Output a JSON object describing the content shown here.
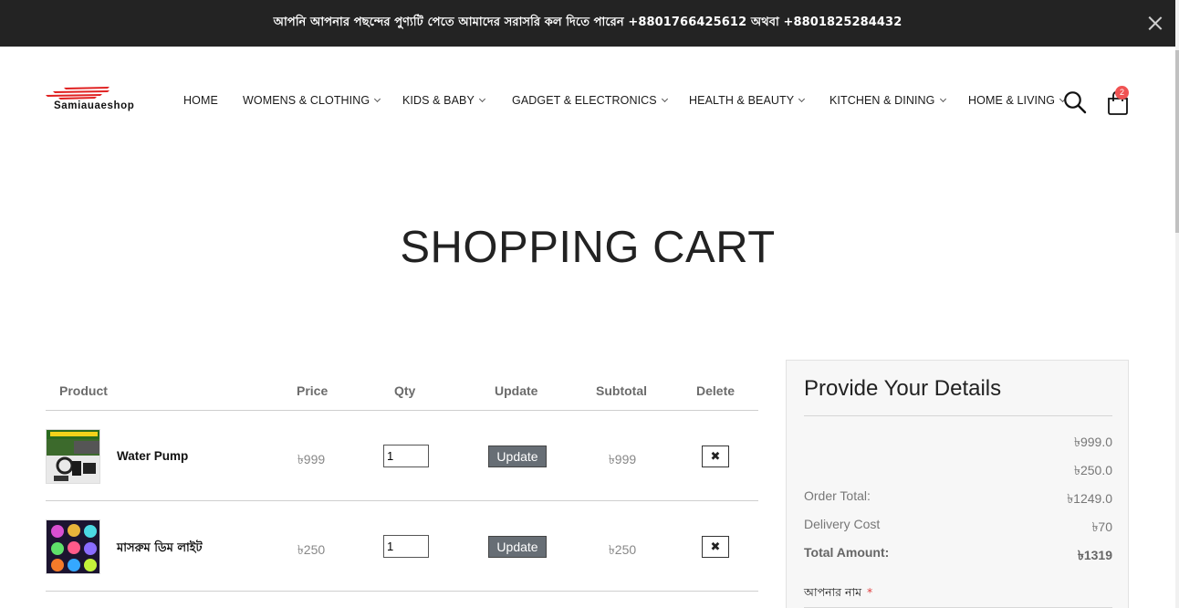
{
  "topbar": {
    "text": "আপনি আপনার পছন্দের পুণ্যটি পেতে আমাদের সরাসরি কল দিতে পারেন +8801766425612 অথবা +8801825284432"
  },
  "header": {
    "logo_text": "Samiauaeshop",
    "nav": [
      {
        "label": "HOME",
        "has_dropdown": false
      },
      {
        "label": "WOMENS & CLOTHING",
        "has_dropdown": true
      },
      {
        "label": "KIDS & BABY",
        "has_dropdown": true
      },
      {
        "label": "GADGET & ELECTRONICS",
        "has_dropdown": true
      },
      {
        "label": "HEALTH & BEAUTY",
        "has_dropdown": true
      },
      {
        "label": "KITCHEN & DINING",
        "has_dropdown": true
      },
      {
        "label": "HOME & LIVING",
        "has_dropdown": true
      }
    ],
    "cart_count": "2"
  },
  "page": {
    "title": "SHOPPING CART"
  },
  "cart": {
    "headers": {
      "product": "Product",
      "price": "Price",
      "qty": "Qty",
      "update": "Update",
      "subtotal": "Subtotal",
      "delete": "Delete"
    },
    "items": [
      {
        "name": "Water Pump",
        "price": "৳999",
        "qty": "1",
        "update_label": "Update",
        "subtotal": "৳999",
        "delete_symbol": "✖"
      },
      {
        "name": "মাসরুম ডিম লাইট",
        "price": "৳250",
        "qty": "1",
        "update_label": "Update",
        "subtotal": "৳250",
        "delete_symbol": "✖"
      }
    ]
  },
  "details": {
    "title": "Provide Your Details",
    "line_items": [
      "৳999.0",
      "৳250.0"
    ],
    "order_total_label": "Order Total:",
    "order_total": "৳1249.0",
    "delivery_label": "Delivery Cost",
    "delivery": "৳70",
    "total_label": "Total Amount:",
    "total": "৳1319",
    "name_field_label": "আপনার নাম",
    "required_mark": "*"
  },
  "colors": {
    "topbar_bg": "#232323",
    "update_button": "#676e75",
    "badge": "#f05252",
    "logo_accent": "#e02020"
  }
}
